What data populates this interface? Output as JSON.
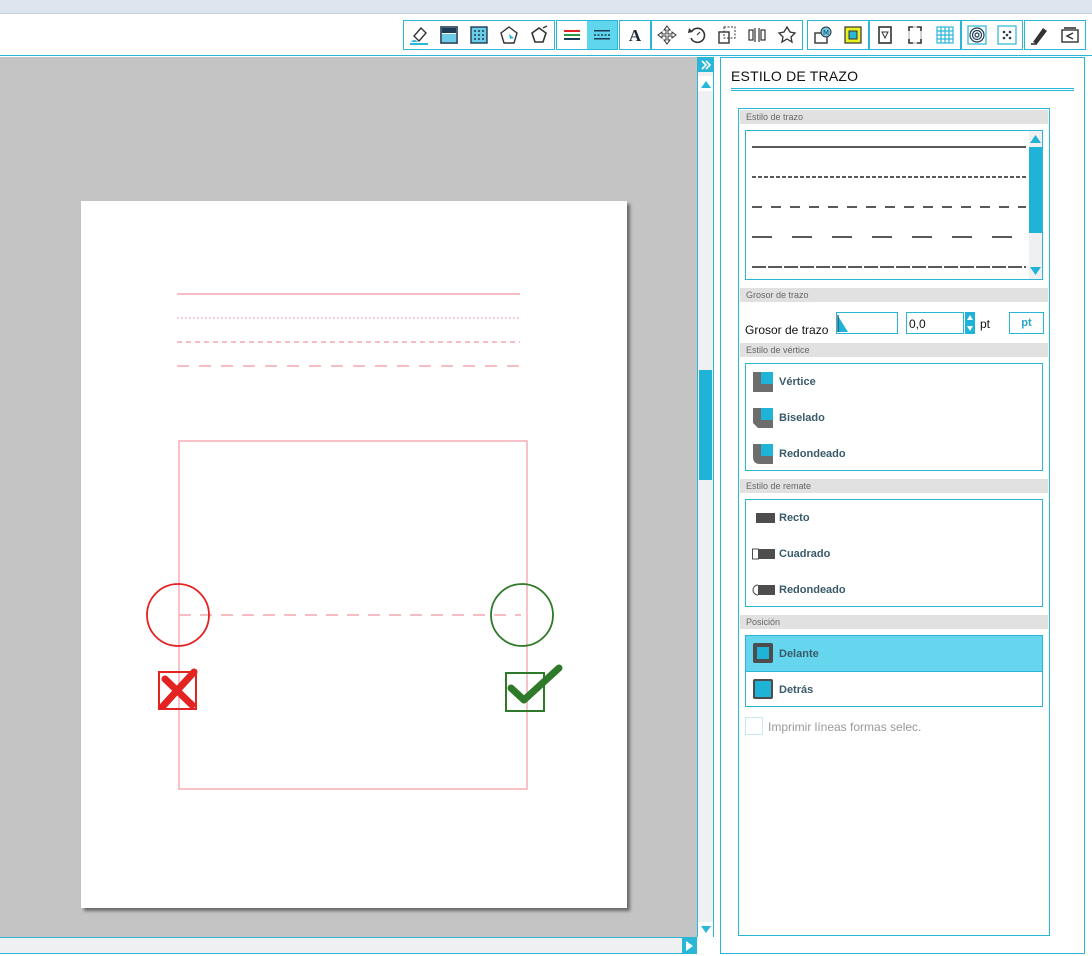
{
  "toolbar": {
    "groups": [
      [
        "eraser-icon",
        "fill-icon",
        "pattern-icon",
        "shape-effects-icon",
        "pentagon-icon"
      ],
      [
        "line-color-icon",
        "line-style-icon"
      ],
      [
        "text-icon"
      ],
      [
        "move-icon",
        "rotate-icon",
        "scale-icon",
        "align-icon",
        "replicate-icon"
      ],
      [
        "modify-icon",
        "offset-icon"
      ],
      [
        "page-setup-icon",
        "registration-marks-icon",
        "grid-icon"
      ],
      [
        "trace-icon",
        "pixscan-icon"
      ],
      [
        "cut-settings-icon",
        "send-icon"
      ]
    ],
    "active": "line-style-icon"
  },
  "panel": {
    "title": "ESTILO DE TRAZO",
    "stroke_style_header": "Estilo de trazo",
    "thickness_header": "Grosor de trazo",
    "thickness_label": "Grosor de trazo",
    "thickness_value": "0,0",
    "thickness_unit": "pt",
    "unit_button": "pt",
    "corner_header": "Estilo de vértice",
    "corners": [
      "Vértice",
      "Biselado",
      "Redondeado"
    ],
    "cap_header": "Estilo de remate",
    "caps": [
      "Recto",
      "Cuadrado",
      "Redondeado"
    ],
    "position_header": "Posición",
    "positions": [
      "Delante",
      "Detrás"
    ],
    "selected_position": "Delante",
    "print_label": "Imprimir líneas formas selec."
  },
  "colors": {
    "accent": "#2ab6d6",
    "selected": "#66d6ee",
    "pink_line": "#f4a8b0",
    "red": "#e32222",
    "green": "#2f7a2a"
  }
}
